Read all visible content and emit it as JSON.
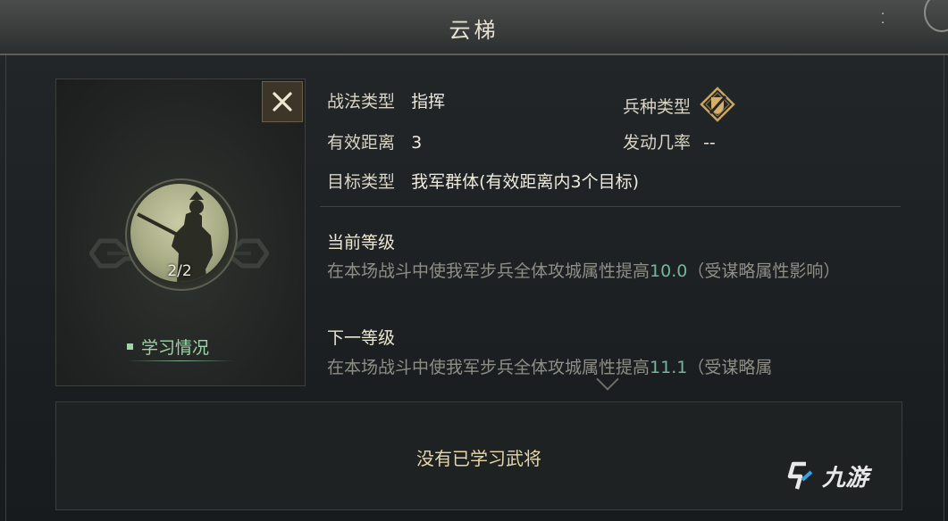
{
  "title": "云梯",
  "close_symbol": "✕",
  "general": {
    "learned_count": "2/2"
  },
  "learn_status_label": "学习情况",
  "info": {
    "tactic_type_label": "战法类型",
    "tactic_type_value": "指挥",
    "troop_type_label": "兵种类型",
    "range_label": "有效距离",
    "range_value": "3",
    "trigger_rate_label": "发动几率",
    "trigger_rate_value": "--",
    "target_type_label": "目标类型",
    "target_type_value": "我军群体(有效距离内3个目标)"
  },
  "current_level": {
    "heading": "当前等级",
    "desc_before": "在本场战斗中使我军步兵全体攻城属性提高",
    "value": "10.0",
    "desc_after": "（受谋略属性影响）"
  },
  "next_level": {
    "heading": "下一等级",
    "desc_before": "在本场战斗中使我军步兵全体攻城属性提高",
    "value": "11.1",
    "desc_after": "（受谋略属"
  },
  "learned_generals_empty": "没有已学习武将",
  "watermark": "九游",
  "icons": {
    "troop_type": "shield-slash-icon",
    "close": "close-icon"
  },
  "colors": {
    "highlight": "#6fb89a",
    "learn_link": "#9fd3a9",
    "empty_text": "#e6d7a8"
  }
}
